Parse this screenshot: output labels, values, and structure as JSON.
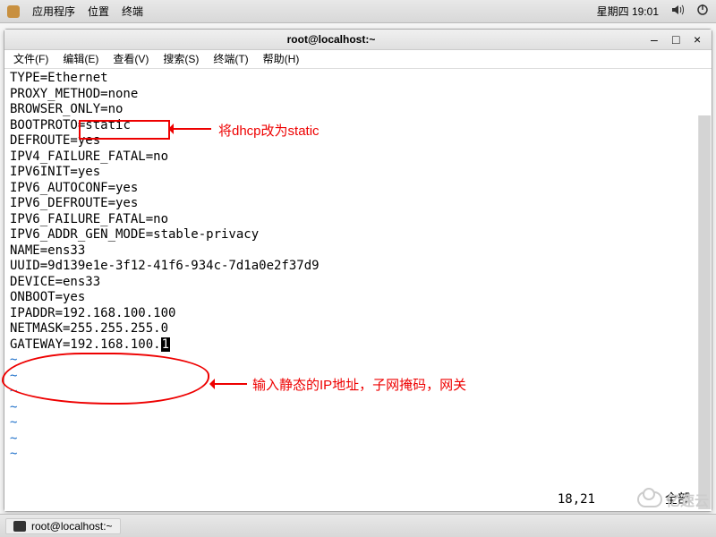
{
  "panel": {
    "app_menu": "应用程序",
    "places": "位置",
    "terminal": "终端",
    "datetime": "星期四 19:01"
  },
  "window": {
    "title": "root@localhost:~"
  },
  "menubar": {
    "file": "文件(F)",
    "edit": "编辑(E)",
    "view": "查看(V)",
    "search": "搜索(S)",
    "terminal": "终端(T)",
    "help": "帮助(H)"
  },
  "config": {
    "l1": "TYPE=Ethernet",
    "l2": "PROXY_METHOD=none",
    "l3": "BROWSER_ONLY=no",
    "l4a": "BOOTPROTO=",
    "l4b": "static",
    "l5": "DEFROUTE=yes",
    "l6": "IPV4_FAILURE_FATAL=no",
    "l7": "IPV6INIT=yes",
    "l8": "IPV6_AUTOCONF=yes",
    "l9": "IPV6_DEFROUTE=yes",
    "l10": "IPV6_FAILURE_FATAL=no",
    "l11": "IPV6_ADDR_GEN_MODE=stable-privacy",
    "l12": "NAME=ens33",
    "l13": "UUID=9d139e1e-3f12-41f6-934c-7d1a0e2f37d9",
    "l14": "DEVICE=ens33",
    "l15": "ONBOOT=yes",
    "l16": "IPADDR=192.168.100.100",
    "l17": "NETMASK=255.255.255.0",
    "l18a": "GATEWAY=192.168.100.",
    "l18b": "1"
  },
  "tilde": "~",
  "status": {
    "pos": "18,21",
    "all": "全部"
  },
  "annotations": {
    "a1": "将dhcp改为static",
    "a2": "输入静态的IP地址，子网掩码，网关"
  },
  "taskbar": {
    "app": "root@localhost:~"
  },
  "watermark": "亿速云"
}
